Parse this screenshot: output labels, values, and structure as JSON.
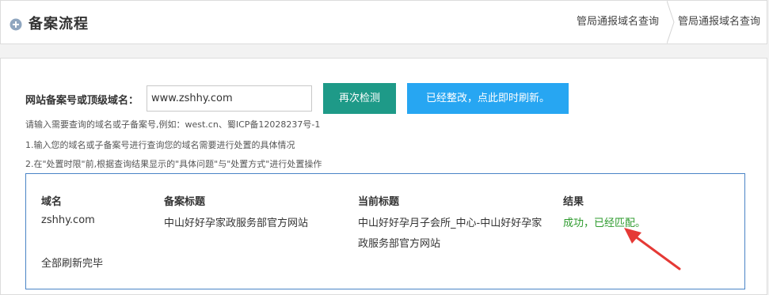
{
  "header": {
    "title": "备案流程",
    "breadcrumbs": [
      "管局通报域名查询",
      "管局通报域名查询"
    ]
  },
  "form": {
    "label": "网站备案号或顶级域名：",
    "input_value": "www.zshhy.com",
    "recheck_label": "再次检测",
    "refresh_label": "已经整改，点此即时刷新。"
  },
  "hints": [
    "请输入需要查询的域名或子备案号,例如：west.cn、蜀ICP备12028237号-1",
    "1.输入您的域名或子备案号进行查询您的域名需要进行处置的具体情况",
    "2.在\"处置时限\"前,根据查询结果显示的\"具体问题\"与\"处置方式\"进行处置操作"
  ],
  "results": {
    "headers": [
      "域名",
      "备案标题",
      "当前标题",
      "结果"
    ],
    "row": {
      "domain": "zshhy.com",
      "record_title": "中山好好孕家政服务部官方网站",
      "current_title_line1": "中山好好孕月子会所_中心-中山好好孕家",
      "current_title_line2": "政服务部官方网站",
      "result": "成功，已经匹配。"
    },
    "footer": "全部刷新完毕"
  },
  "colors": {
    "recheck_button": "#1e9a88",
    "refresh_button": "#27a6f2",
    "success_text": "#2e9b2e",
    "annotation_arrow": "#e53935"
  },
  "icons": {
    "title_icon": "plus-circle-icon",
    "annotation": "red-arrow-icon"
  }
}
